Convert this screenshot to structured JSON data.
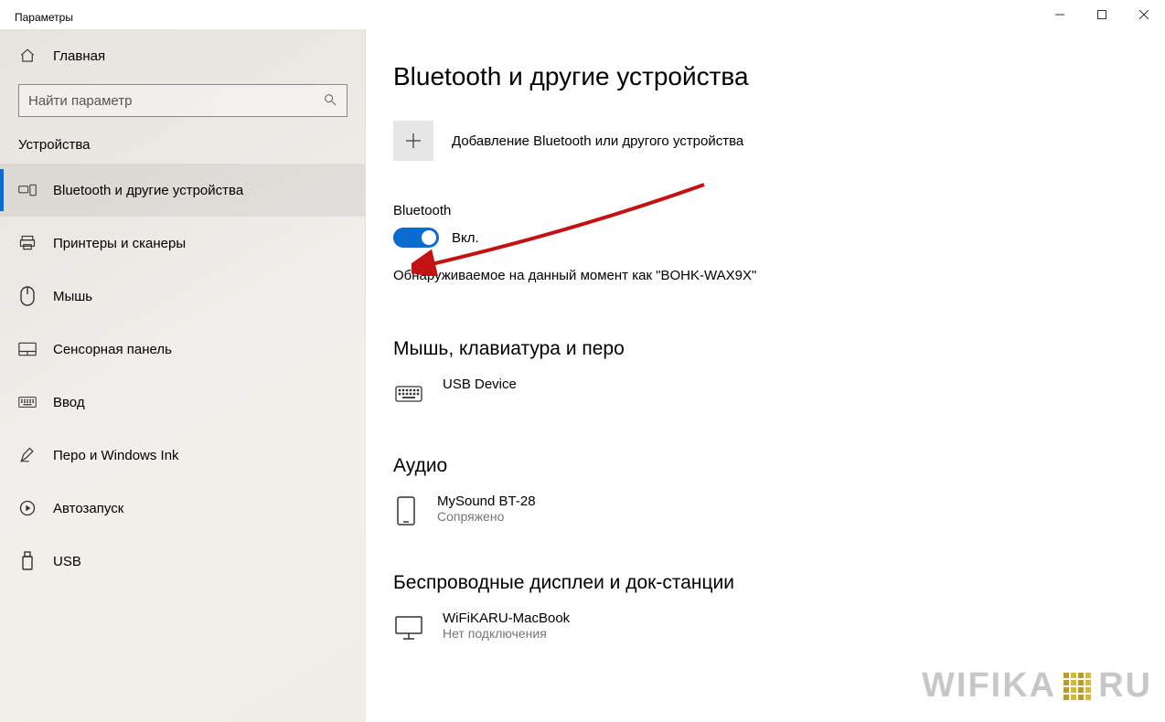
{
  "window": {
    "title": "Параметры"
  },
  "sidebar": {
    "home_label": "Главная",
    "search_placeholder": "Найти параметр",
    "section_label": "Устройства",
    "items": [
      {
        "label": "Bluetooth и другие устройства",
        "icon": "devices-icon",
        "active": true
      },
      {
        "label": "Принтеры и сканеры",
        "icon": "printer-icon",
        "active": false
      },
      {
        "label": "Мышь",
        "icon": "mouse-icon",
        "active": false
      },
      {
        "label": "Сенсорная панель",
        "icon": "touchpad-icon",
        "active": false
      },
      {
        "label": "Ввод",
        "icon": "keyboard-icon",
        "active": false
      },
      {
        "label": "Перо и Windows Ink",
        "icon": "pen-icon",
        "active": false
      },
      {
        "label": "Автозапуск",
        "icon": "autoplay-icon",
        "active": false
      },
      {
        "label": "USB",
        "icon": "usb-icon",
        "active": false
      }
    ]
  },
  "main": {
    "page_title": "Bluetooth и другие устройства",
    "add_device_label": "Добавление Bluetooth или другого устройства",
    "bluetooth_label": "Bluetooth",
    "toggle_state_label": "Вкл.",
    "toggle_on": true,
    "discoverable_text": "Обнаруживаемое на данный момент как \"BOHK-WAX9X\"",
    "section_mouse_kbd": "Мышь, клавиатура и перо",
    "device_usb": {
      "name": "USB Device"
    },
    "section_audio": "Аудио",
    "device_audio": {
      "name": "MySound BT-28",
      "status": "Сопряжено"
    },
    "section_wireless": "Беспроводные дисплеи и док-станции",
    "device_display": {
      "name": "WiFiKARU-MacBook",
      "status": "Нет подключения"
    }
  },
  "watermark": {
    "text_left": "WIFIKA",
    "text_right": "RU"
  }
}
